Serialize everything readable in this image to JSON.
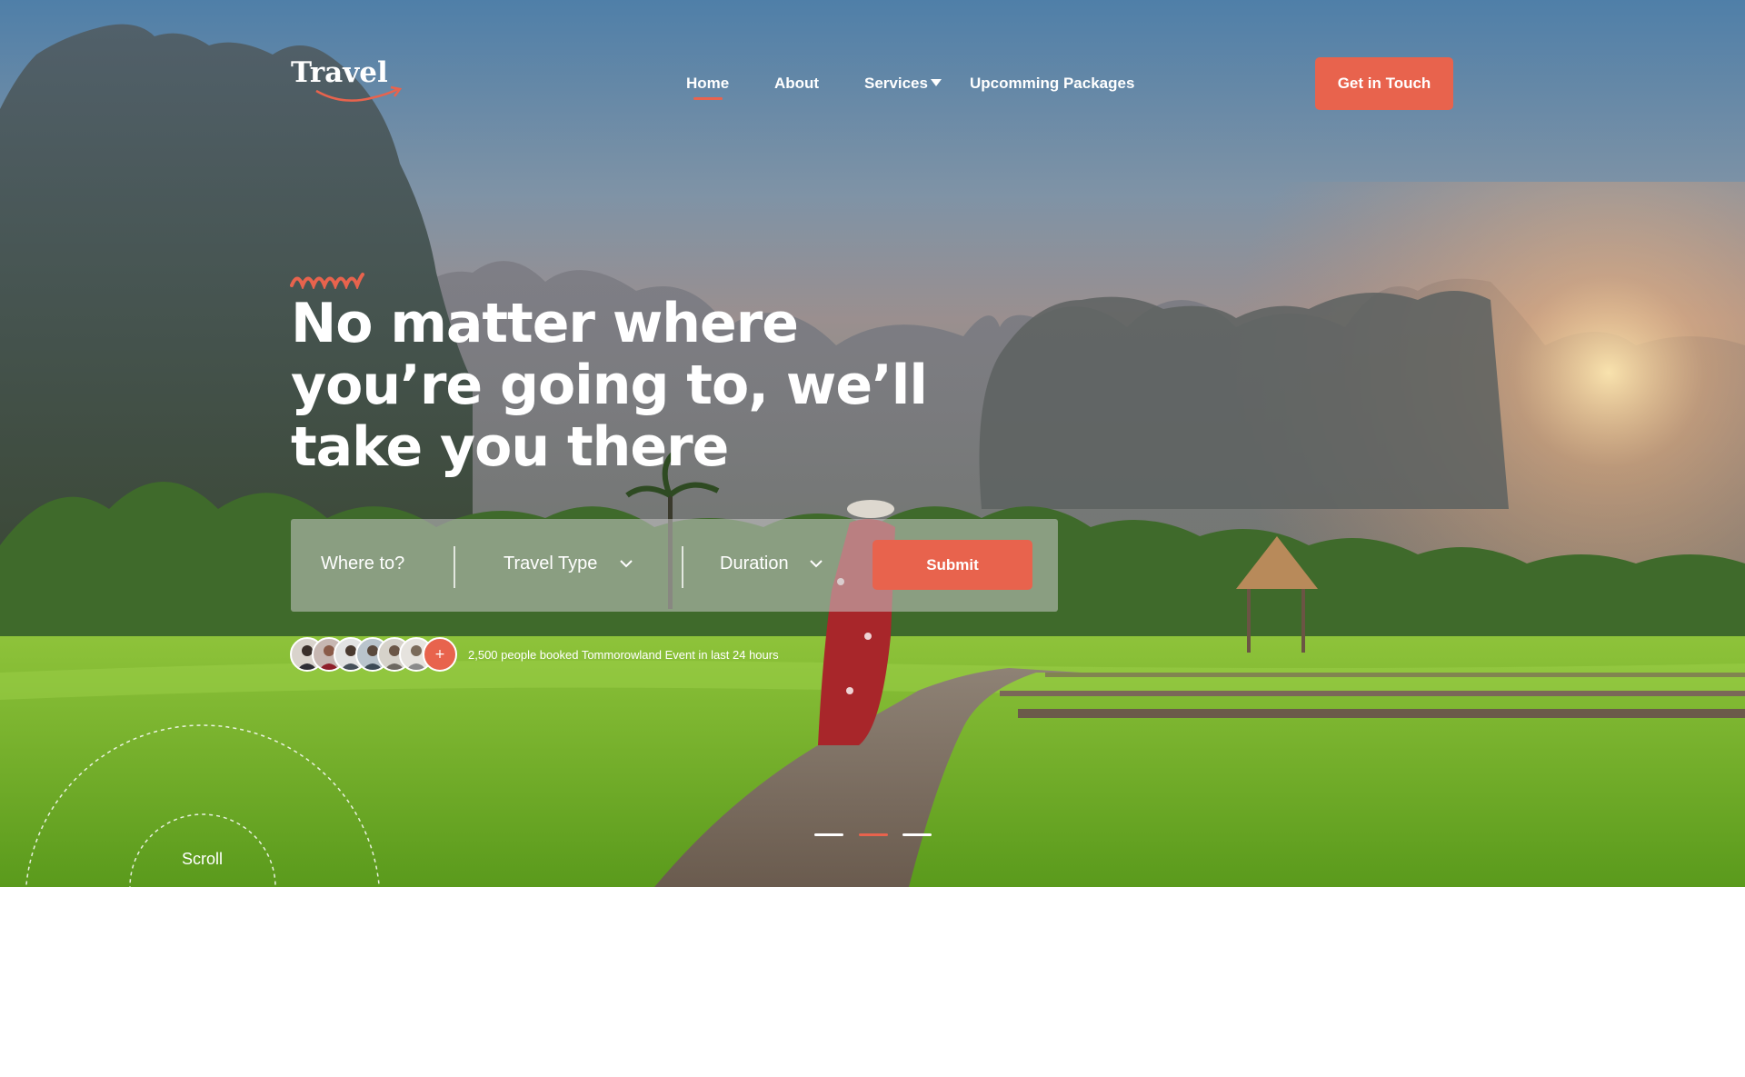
{
  "brand": {
    "logo_text": "Travel"
  },
  "nav": {
    "home": "Home",
    "about": "About",
    "services": "Services",
    "packages": "Upcomming Packages",
    "cta": "Get in Touch"
  },
  "hero": {
    "headline_line1": "No matter where",
    "headline_line2": "you’re going to, we’ll",
    "headline_line3": "take you there"
  },
  "search": {
    "where_placeholder": "Where to?",
    "travel_type": "Travel Type",
    "duration": "Duration",
    "submit": "Submit"
  },
  "social_proof": {
    "plus_symbol": "+",
    "booked_text": "2,500 people booked Tommorowland Event in last 24 hours"
  },
  "scroll": {
    "label": "Scroll"
  },
  "slider": {
    "count": 3,
    "active_index": 1
  },
  "colors": {
    "accent": "#e8634d",
    "text_on_hero": "#ffffff",
    "slider_inactive": "#ffffff"
  }
}
